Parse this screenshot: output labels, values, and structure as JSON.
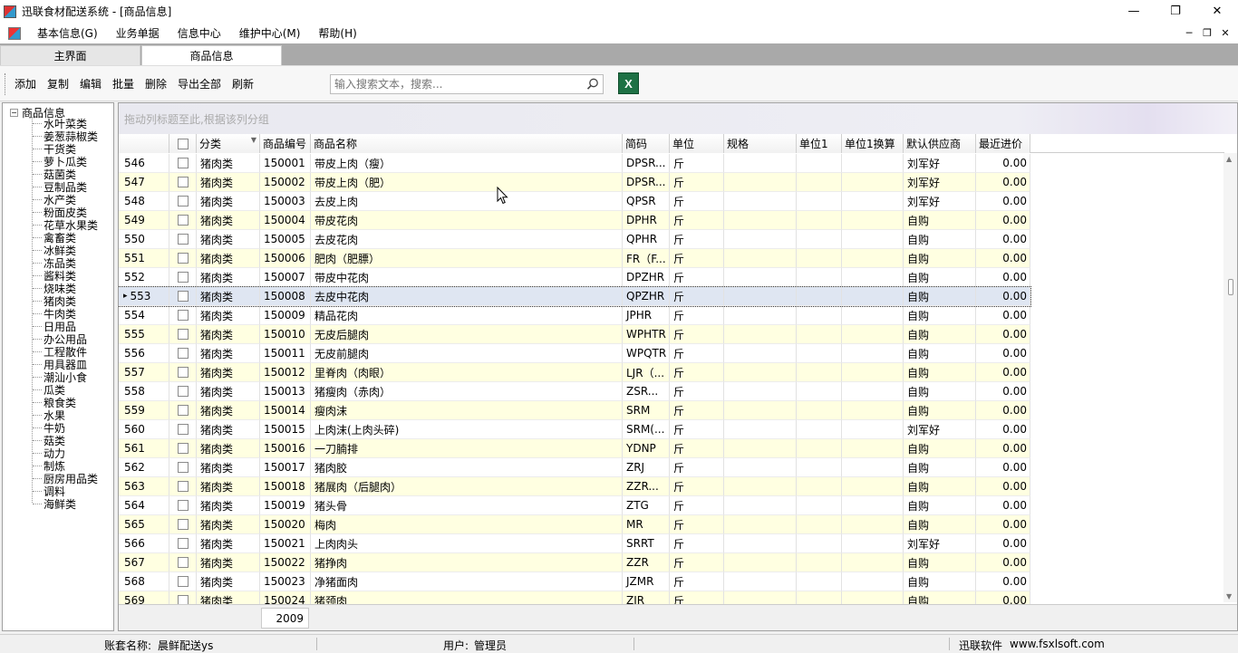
{
  "window": {
    "title": "迅联食材配送系统 - [商品信息]"
  },
  "menu": [
    "基本信息(G)",
    "业务单据",
    "信息中心",
    "维护中心(M)",
    "帮助(H)"
  ],
  "tabs": [
    {
      "label": "主界面",
      "active": false
    },
    {
      "label": "商品信息",
      "active": true
    }
  ],
  "toolbar": {
    "buttons": [
      "添加",
      "复制",
      "编辑",
      "批量",
      "删除",
      "导出全部",
      "刷新"
    ],
    "search_placeholder": "输入搜索文本，搜索...",
    "excel_icon": "excel-icon"
  },
  "tree": {
    "root": "商品信息",
    "items": [
      "水叶菜类",
      "姜葱蒜椒类",
      "干货类",
      "萝卜瓜类",
      "菇菌类",
      "豆制品类",
      "水产类",
      "粉面皮类",
      "花草水果类",
      "禽畜类",
      "冰鲜类",
      "冻品类",
      "酱料类",
      "烧味类",
      "猪肉类",
      "牛肉类",
      "日用品",
      "办公用品",
      "工程散件",
      "用具器皿",
      "潮汕小食",
      "瓜类",
      "粮食类",
      "水果",
      "牛奶",
      "菇类",
      "动力",
      "制炼",
      "厨房用品类",
      "调料",
      "海鲜类"
    ]
  },
  "grid": {
    "group_hint": "拖动列标题至此,根据该列分组",
    "columns": [
      "",
      "分类",
      "商品编号",
      "商品名称",
      "简码",
      "单位",
      "规格",
      "单位1",
      "单位1换算",
      "默认供应商",
      "最近进价"
    ],
    "rows": [
      [
        "546",
        "猪肉类",
        "150001",
        "带皮上肉（瘦）",
        "DPSR...",
        "斤",
        "",
        "",
        "",
        "刘军好",
        "0.00"
      ],
      [
        "547",
        "猪肉类",
        "150002",
        "带皮上肉（肥）",
        "DPSR...",
        "斤",
        "",
        "",
        "",
        "刘军好",
        "0.00"
      ],
      [
        "548",
        "猪肉类",
        "150003",
        "去皮上肉",
        "QPSR",
        "斤",
        "",
        "",
        "",
        "刘军好",
        "0.00"
      ],
      [
        "549",
        "猪肉类",
        "150004",
        "带皮花肉",
        "DPHR",
        "斤",
        "",
        "",
        "",
        "自购",
        "0.00"
      ],
      [
        "550",
        "猪肉类",
        "150005",
        "去皮花肉",
        "QPHR",
        "斤",
        "",
        "",
        "",
        "自购",
        "0.00"
      ],
      [
        "551",
        "猪肉类",
        "150006",
        "肥肉（肥膘）",
        "FR（F...",
        "斤",
        "",
        "",
        "",
        "自购",
        "0.00"
      ],
      [
        "552",
        "猪肉类",
        "150007",
        "带皮中花肉",
        "DPZHR",
        "斤",
        "",
        "",
        "",
        "自购",
        "0.00"
      ],
      [
        "553",
        "猪肉类",
        "150008",
        "去皮中花肉",
        "QPZHR",
        "斤",
        "",
        "",
        "",
        "自购",
        "0.00"
      ],
      [
        "554",
        "猪肉类",
        "150009",
        "精品花肉",
        "JPHR",
        "斤",
        "",
        "",
        "",
        "自购",
        "0.00"
      ],
      [
        "555",
        "猪肉类",
        "150010",
        "无皮后腿肉",
        "WPHTR",
        "斤",
        "",
        "",
        "",
        "自购",
        "0.00"
      ],
      [
        "556",
        "猪肉类",
        "150011",
        "无皮前腿肉",
        "WPQTR",
        "斤",
        "",
        "",
        "",
        "自购",
        "0.00"
      ],
      [
        "557",
        "猪肉类",
        "150012",
        "里脊肉（肉眼）",
        "LJR（...",
        "斤",
        "",
        "",
        "",
        "自购",
        "0.00"
      ],
      [
        "558",
        "猪肉类",
        "150013",
        "猪瘦肉（赤肉）",
        "ZSR...",
        "斤",
        "",
        "",
        "",
        "自购",
        "0.00"
      ],
      [
        "559",
        "猪肉类",
        "150014",
        "瘦肉沫",
        "SRM",
        "斤",
        "",
        "",
        "",
        "自购",
        "0.00"
      ],
      [
        "560",
        "猪肉类",
        "150015",
        "上肉沫(上肉头碎)",
        "SRM(...",
        "斤",
        "",
        "",
        "",
        "刘军好",
        "0.00"
      ],
      [
        "561",
        "猪肉类",
        "150016",
        "一刀腩排",
        "YDNP",
        "斤",
        "",
        "",
        "",
        "自购",
        "0.00"
      ],
      [
        "562",
        "猪肉类",
        "150017",
        "猪肉胶",
        "ZRJ",
        "斤",
        "",
        "",
        "",
        "自购",
        "0.00"
      ],
      [
        "563",
        "猪肉类",
        "150018",
        "猪展肉（后腿肉）",
        "ZZR...",
        "斤",
        "",
        "",
        "",
        "自购",
        "0.00"
      ],
      [
        "564",
        "猪肉类",
        "150019",
        "猪头骨",
        "ZTG",
        "斤",
        "",
        "",
        "",
        "自购",
        "0.00"
      ],
      [
        "565",
        "猪肉类",
        "150020",
        "梅肉",
        "MR",
        "斤",
        "",
        "",
        "",
        "自购",
        "0.00"
      ],
      [
        "566",
        "猪肉类",
        "150021",
        "上肉肉头",
        "SRRT",
        "斤",
        "",
        "",
        "",
        "刘军好",
        "0.00"
      ],
      [
        "567",
        "猪肉类",
        "150022",
        "猪挣肉",
        "ZZR",
        "斤",
        "",
        "",
        "",
        "自购",
        "0.00"
      ],
      [
        "568",
        "猪肉类",
        "150023",
        "净猪面肉",
        "JZMR",
        "斤",
        "",
        "",
        "",
        "自购",
        "0.00"
      ],
      [
        "569",
        "猪肉类",
        "150024",
        "猪颈肉",
        "ZJR",
        "斤",
        "",
        "",
        "",
        "自购",
        "0.00"
      ]
    ],
    "selected_row": "553",
    "total_count": "2009"
  },
  "statusbar": {
    "account_label": "账套名称:",
    "account_value": "晨鲜配送ys",
    "user_label": "用户:",
    "user_value": "管理员",
    "company": "迅联软件",
    "website": "www.fsxlsoft.com"
  }
}
